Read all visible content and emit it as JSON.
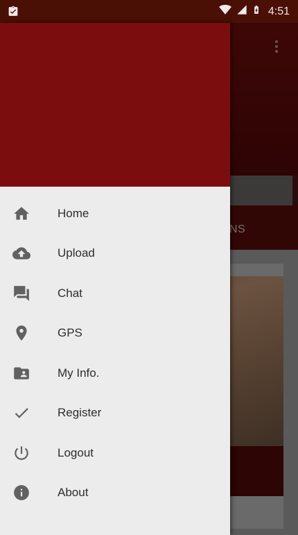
{
  "status_bar": {
    "time": "4:51",
    "left_icon": "clipboard-check-icon",
    "icons": [
      "wifi-icon",
      "signal-icon",
      "battery-charging-icon"
    ]
  },
  "background_app": {
    "tab_label": "ONS",
    "overflow_icon": "more-vert-icon"
  },
  "drawer": {
    "header_color": "#7c0d0f",
    "items": [
      {
        "label": "Home",
        "icon": "home-icon"
      },
      {
        "label": "Upload",
        "icon": "cloud-upload-icon"
      },
      {
        "label": "Chat",
        "icon": "chat-icon"
      },
      {
        "label": "GPS",
        "icon": "location-pin-icon"
      },
      {
        "label": "My Info.",
        "icon": "contact-folder-icon"
      },
      {
        "label": "Register",
        "icon": "check-icon"
      },
      {
        "label": "Logout",
        "icon": "power-icon"
      },
      {
        "label": "About",
        "icon": "info-icon"
      }
    ]
  }
}
